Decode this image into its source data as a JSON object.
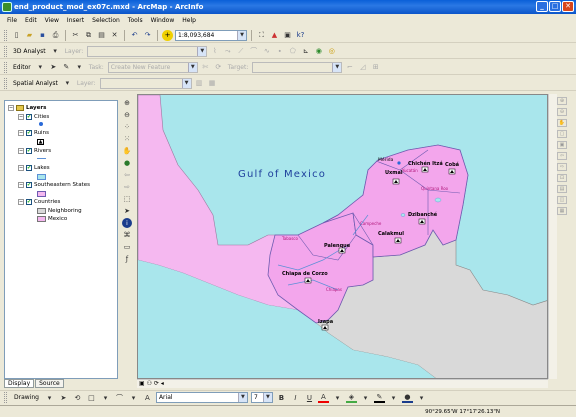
{
  "window": {
    "title": "end_product_mod_ex07c.mxd - ArcMap - ArcInfo"
  },
  "menu": [
    "File",
    "Edit",
    "View",
    "Insert",
    "Selection",
    "Tools",
    "Window",
    "Help"
  ],
  "toolbar": {
    "scale": "1:8,093,684"
  },
  "analyst3d": {
    "label": "3D Analyst",
    "layer_label": "Layer:"
  },
  "editor": {
    "label": "Editor",
    "task_label": "Task:",
    "task_value": "Create New Feature",
    "target_label": "Target:"
  },
  "spatial": {
    "label": "Spatial Analyst",
    "layer_label": "Layer:"
  },
  "toc": {
    "root": "Layers",
    "layers": [
      {
        "name": "Cities"
      },
      {
        "name": "Ruins"
      },
      {
        "name": "Rivers"
      },
      {
        "name": "Lakes"
      },
      {
        "name": "Southeastern States"
      },
      {
        "name": "Countries",
        "classes": [
          "Neighboring",
          "Mexico"
        ]
      }
    ],
    "tabs": [
      "Display",
      "Source"
    ]
  },
  "map": {
    "water_label": "Gulf of Mexico",
    "cities": [
      "Mérida",
      "Chichén Itzá",
      "Cobá",
      "Uxmal",
      "Dzibanché",
      "Calakmul",
      "Palenque",
      "Chiapa de Corzo",
      "Izapa"
    ],
    "states": [
      "Yucatán",
      "Quintana Roo",
      "Campeche",
      "Tabasco",
      "Chiapas"
    ],
    "colors": {
      "water": "#a9e6ec",
      "mexico": "#f5b8f0",
      "neighboring": "#d9d9d9",
      "outline": "#6d5bb0"
    }
  },
  "drawing": {
    "label": "Drawing",
    "font": "Arial",
    "size": "7",
    "bold": "B",
    "italic": "I",
    "underline": "U",
    "font_color": "A"
  },
  "status": {
    "coords": "90°29.65'W  17°17'26.13\"N"
  }
}
